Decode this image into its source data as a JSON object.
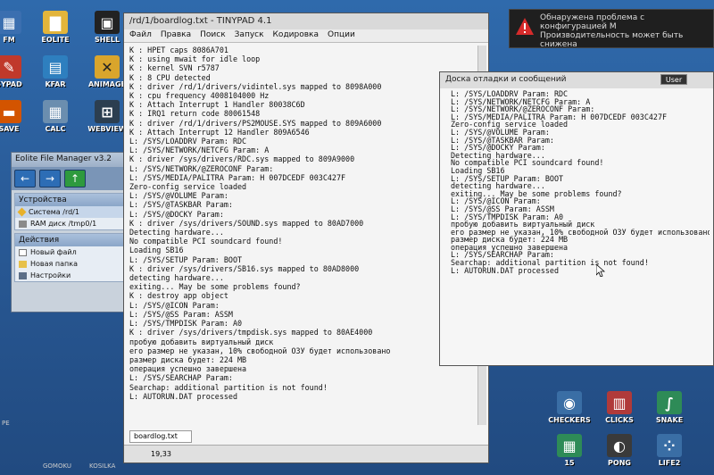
{
  "desktop_icons": [
    {
      "label": "FM",
      "x": "l1",
      "glyph": "▦",
      "bg": "#3b6fb0"
    },
    {
      "label": "EOLITE",
      "glyph": "▇",
      "bg": "#e3b53b"
    },
    {
      "label": "SHELL",
      "glyph": "▣",
      "bg": "#222"
    },
    {
      "label": "SYPAD",
      "glyph": "✎",
      "bg": "#c0392b"
    },
    {
      "label": "KFAR",
      "glyph": "▤",
      "bg": "#2e7fbf"
    },
    {
      "label": "ANIMAGE",
      "glyph": "✕",
      "bg": "#d9a52c"
    },
    {
      "label": "SAVE",
      "glyph": "▬",
      "bg": "#d35400"
    },
    {
      "label": "CALC",
      "glyph": "▦",
      "bg": "#6b8eaf"
    },
    {
      "label": "WEBVIEW",
      "glyph": "⊞",
      "bg": "#2c3e50"
    }
  ],
  "game_icons": [
    {
      "label": "CHECKERS",
      "glyph": "◉",
      "bg": "#3a6ea5"
    },
    {
      "label": "CLICKS",
      "glyph": "▥",
      "bg": "#b03a3a"
    },
    {
      "label": "SNAKE",
      "glyph": "∫",
      "bg": "#2e8b57"
    },
    {
      "label": "15",
      "glyph": "▦",
      "bg": "#2e8b57"
    },
    {
      "label": "PONG",
      "glyph": "◐",
      "bg": "#3a3a3a"
    },
    {
      "label": "LIFE2",
      "glyph": "⁘",
      "bg": "#3a6ea5"
    }
  ],
  "notification": {
    "line1": "Обнаружена проблема с конфигурацией M",
    "line2": "Производительность может быть снижена"
  },
  "file_manager": {
    "title": "Eolite File Manager v3.2",
    "devices_header": "Устройства",
    "devices": [
      "Система /rd/1",
      "RAM диск /tmp0/1"
    ],
    "actions_header": "Действия",
    "actions": [
      "Новый файл",
      "Новая папка",
      "Настройки"
    ]
  },
  "tinypad": {
    "title": "/rd/1/boardlog.txt - TINYPAD 4.1",
    "menu": [
      "Файл",
      "Правка",
      "Поиск",
      "Запуск",
      "Кодировка",
      "Опции"
    ],
    "text": "K : HPET caps 8086A701\nK : using mwait for idle loop\nK : kernel SVN r5787\nK : 8 CPU detected\nK : driver /rd/1/drivers/vidintel.sys mapped to 8098A000\nK : cpu frequency 4008104000 Hz\nK : Attach Interrupt 1 Handler 80038C6D\nK : IRQ1 return code 80061548\nK : driver /rd/1/drivers/PS2MOUSE.SYS mapped to 809A6000\nK : Attach Interrupt 12 Handler 809A6546\nL: /SYS/LOADDRV Param: RDC\nL: /SYS/NETWORK/NETCFG Param: A\nK : driver /sys/drivers/RDC.sys mapped to 809A9000\nL: /SYS/NETWORK/@ZEROCONF Param:\nL: /SYS/MEDIA/PALITRA Param: H 007DCEDF 003C427F\nZero-config service loaded\nL: /SYS/@VOLUME Param:\nL: /SYS/@TASKBAR Param:\nL: /SYS/@DOCKY Param:\nK : driver /sys/drivers/SOUND.sys mapped to 80AD7000\nDetecting hardware...\nNo compatible PCI soundcard found!\nLoading SB16\nL: /SYS/SETUP Param: BOOT\nK : driver /sys/drivers/SB16.sys mapped to 80AD8000\ndetecting hardware...\nexiting... May be some problems found?\nK : destroy app object\nL: /SYS/@ICON Param:\nL: /SYS/@SS Param: ASSM\nL: /SYS/TMPDISK Param: A0\nK : driver /sys/drivers/tmpdisk.sys mapped to 80AE4000\nпробую добавить виртуальный диск\nего размер не указан, 10% свободной ОЗУ будет использовано\nразмер диска будет: 224 MB\nоперация успешно завершена\nL: /SYS/SEARCHAP Param:\nSearchap: additional partition is not found!\nL: AUTORUN.DAT processed",
    "tab": "boardlog.txt",
    "status": "19,33"
  },
  "debug_board": {
    "title": "Доска отладки и сообщений",
    "user_label": "User",
    "text": "L: /SYS/LOADDRV Param: RDC\nL: /SYS/NETWORK/NETCFG Param: A\nL: /SYS/NETWORK/@ZEROCONF Param:\nL: /SYS/MEDIA/PALITRA Param: H 007DCEDF 003C427F\nZero-config service loaded\nL: /SYS/@VOLUME Param:\nL: /SYS/@TASKBAR Param:\nL: /SYS/@DOCKY Param:\nDetecting hardware...\nNo compatible PCI soundcard found!\nLoading SB16\nL: /SYS/SETUP Param: BOOT\ndetecting hardware...\nexiting... May be some problems found?\nL: /SYS/@ICON Param:\nL: /SYS/@SS Param: ASSM\nL: /SYS/TMPDISK Param: A0\nпробую добавить виртуальный диск\nего размер не указан, 10% свободной ОЗУ будет использовано\nразмер диска будет: 224 MB\nоперация успешно завершена\nL: /SYS/SEARCHAP Param:\nSearchap: additional partition is not found!\nL: AUTORUN.DAT processed"
  },
  "bottom_labels": [
    "GOMOKU",
    "KOSILKA",
    "PE"
  ]
}
